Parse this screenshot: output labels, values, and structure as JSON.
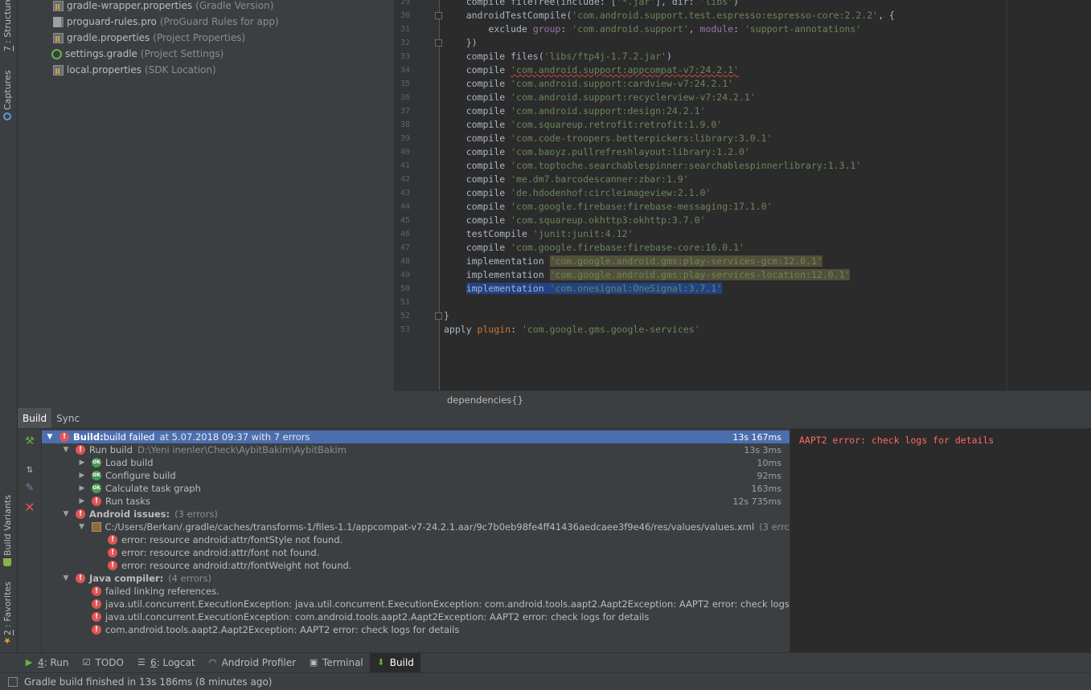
{
  "left_strip": {
    "structure_number": "7",
    "structure_rest": ": Structure",
    "captures": "Captures",
    "build_variants": "Build Variants",
    "favorites_number": "2",
    "favorites_rest": ": Favorites"
  },
  "project_tree": [
    {
      "name": "gradle-wrapper.properties",
      "hint": "(Gradle Version)",
      "icon": "properties-file-icon"
    },
    {
      "name": "proguard-rules.pro",
      "hint": "(ProGuard Rules for app)",
      "icon": "text-file-icon"
    },
    {
      "name": "gradle.properties",
      "hint": "(Project Properties)",
      "icon": "properties-file-icon"
    },
    {
      "name": "settings.gradle",
      "hint": "(Project Settings)",
      "icon": "gradle-file-icon"
    },
    {
      "name": "local.properties",
      "hint": "(SDK Location)",
      "icon": "properties-file-icon"
    }
  ],
  "editor": {
    "line_numbers": [
      "29",
      "30",
      "31",
      "32",
      "33",
      "34",
      "35",
      "36",
      "37",
      "38",
      "39",
      "40",
      "41",
      "42",
      "43",
      "44",
      "45",
      "46",
      "47",
      "48",
      "49",
      "50",
      "51",
      "52",
      "53"
    ],
    "lines": [
      {
        "indent": "    ",
        "kw": "compile fileTree(include: [",
        "str": "'*.jar'",
        "rest": "], dir: ",
        "str2": "'libs'",
        "rest2": ")"
      },
      {
        "indent": "    ",
        "kw": "androidTestCompile(",
        "str": "'com.android.support.test.espresso:espresso-core:2.2.2'",
        "rest": ", {",
        "str2": "",
        "rest2": ""
      },
      {
        "indent": "        ",
        "kw": "exclude ",
        "str": "",
        "rest": "",
        "group_line": true
      },
      {
        "indent": "    ",
        "kw": "})",
        "str": "",
        "rest": ""
      },
      {
        "indent": "    ",
        "kw": "compile files(",
        "str": "'libs/ftp4j-1.7.2.jar'",
        "rest": ")"
      },
      {
        "indent": "    ",
        "kw": "compile ",
        "str": "'com.android.support:appcompat-v7:24.2.1'",
        "rest": "",
        "err": true
      },
      {
        "indent": "    ",
        "kw": "compile ",
        "str": "'com.android.support:cardview-v7:24.2.1'",
        "rest": ""
      },
      {
        "indent": "    ",
        "kw": "compile ",
        "str": "'com.android.support:recyclerview-v7:24.2.1'",
        "rest": ""
      },
      {
        "indent": "    ",
        "kw": "compile ",
        "str": "'com.android.support:design:24.2.1'",
        "rest": ""
      },
      {
        "indent": "    ",
        "kw": "compile ",
        "str": "'com.squareup.retrofit:retrofit:1.9.0'",
        "rest": ""
      },
      {
        "indent": "    ",
        "kw": "compile ",
        "str": "'com.code-troopers.betterpickers:library:3.0.1'",
        "rest": ""
      },
      {
        "indent": "    ",
        "kw": "compile ",
        "str": "'com.baoyz.pullrefreshlayout:library:1.2.0'",
        "rest": ""
      },
      {
        "indent": "    ",
        "kw": "compile ",
        "str": "'com.toptoche.searchablespinner:searchablespinnerlibrary:1.3.1'",
        "rest": ""
      },
      {
        "indent": "    ",
        "kw": "compile ",
        "str": "'me.dm7.barcodescanner:zbar:1.9'",
        "rest": ""
      },
      {
        "indent": "    ",
        "kw": "compile ",
        "str": "'de.hdodenhof:circleimageview:2.1.0'",
        "rest": ""
      },
      {
        "indent": "    ",
        "kw": "compile ",
        "str": "'com.google.firebase:firebase-messaging:17.1.0'",
        "rest": ""
      },
      {
        "indent": "    ",
        "kw": "compile ",
        "str": "'com.squareup.okhttp3:okhttp:3.7.0'",
        "rest": ""
      },
      {
        "indent": "    ",
        "kw": "testCompile ",
        "str": "'junit:junit:4.12'",
        "rest": ""
      },
      {
        "indent": "    ",
        "kw": "compile ",
        "str": "'com.google.firebase:firebase-core:16.0.1'",
        "rest": ""
      },
      {
        "indent": "    ",
        "kw": "implementation ",
        "str": "'com.google.android.gms:play-services-gcm:12.0.1'",
        "rest": "",
        "warn": true
      },
      {
        "indent": "    ",
        "kw": "implementation ",
        "str": "'com.google.android.gms:play-services-location:12.0.1'",
        "rest": "",
        "warn": true
      },
      {
        "indent": "    ",
        "kw": "implementation ",
        "str": "'com.onesignal:OneSignal:3.7.1'",
        "rest": "",
        "sel": true
      },
      {
        "indent": "",
        "kw": "",
        "str": "",
        "rest": ""
      },
      {
        "indent": "",
        "kw": "}",
        "str": "",
        "rest": ""
      },
      {
        "indent": "",
        "kw": "apply ",
        "str": "'com.google.gms.google-services'",
        "rest": "",
        "plugin_line": true
      }
    ],
    "exclude_group_key": "group",
    "exclude_group_val": "'com.android.support'",
    "exclude_module_key": "module",
    "exclude_module_val": "'support-annotations'",
    "plugin_key": "plugin",
    "breadcrumb": "dependencies{}"
  },
  "build_window": {
    "tabs": [
      "Build",
      "Sync"
    ],
    "active_tab": "Build",
    "rows": [
      {
        "indent": 0,
        "arrow": "open",
        "icon": "err",
        "label": "Build:",
        "bold_label": true,
        "text": " build failed",
        "dim": "at 5.07.2018 09:37   with 7 errors",
        "dur": "13s 167ms",
        "sel": true
      },
      {
        "indent": 1,
        "arrow": "open",
        "icon": "err",
        "label": "Run build",
        "dim": "D:\\Yeni inenler\\Check\\AybitBakim\\AybitBakim",
        "dur": "13s 3ms"
      },
      {
        "indent": 2,
        "arrow": "closed",
        "icon": "ok",
        "label": "Load build",
        "dur": "10ms"
      },
      {
        "indent": 2,
        "arrow": "closed",
        "icon": "ok",
        "label": "Configure build",
        "dur": "92ms"
      },
      {
        "indent": 2,
        "arrow": "closed",
        "icon": "ok",
        "label": "Calculate task graph",
        "dur": "163ms"
      },
      {
        "indent": 2,
        "arrow": "closed",
        "icon": "err",
        "label": "Run tasks",
        "dur": "12s 735ms"
      },
      {
        "indent": 1,
        "arrow": "open",
        "icon": "err",
        "label": "Android issues:",
        "bold_label": true,
        "dim": "(3 errors)"
      },
      {
        "indent": 2,
        "arrow": "open",
        "icon": "file",
        "label": "C:/Users/Berkan/.gradle/caches/transforms-1/files-1.1/appcompat-v7-24.2.1.aar/9c7b0eb98fe4ff41436aedcaee3f9e46/res/values/values.xml",
        "dim": "(3 errc"
      },
      {
        "indent": 3,
        "arrow": "none",
        "icon": "err",
        "label": "error: resource android:attr/fontStyle not found."
      },
      {
        "indent": 3,
        "arrow": "none",
        "icon": "err",
        "label": "error: resource android:attr/font not found."
      },
      {
        "indent": 3,
        "arrow": "none",
        "icon": "err",
        "label": "error: resource android:attr/fontWeight not found."
      },
      {
        "indent": 1,
        "arrow": "open",
        "icon": "err",
        "label": "Java compiler:",
        "bold_label": true,
        "dim": "(4 errors)"
      },
      {
        "indent": 2,
        "arrow": "none",
        "icon": "err",
        "label": "failed linking references."
      },
      {
        "indent": 2,
        "arrow": "none",
        "icon": "err",
        "label": "java.util.concurrent.ExecutionException: java.util.concurrent.ExecutionException: com.android.tools.aapt2.Aapt2Exception: AAPT2 error: check logs"
      },
      {
        "indent": 2,
        "arrow": "none",
        "icon": "err",
        "label": "java.util.concurrent.ExecutionException: com.android.tools.aapt2.Aapt2Exception: AAPT2 error: check logs for details"
      },
      {
        "indent": 2,
        "arrow": "none",
        "icon": "err",
        "label": "com.android.tools.aapt2.Aapt2Exception: AAPT2 error: check logs for details"
      }
    ],
    "output": "AAPT2 error: check logs for details"
  },
  "bottom_tools": [
    {
      "num": "4",
      "rest": ": Run",
      "icon": "run-icon",
      "name": "run"
    },
    {
      "num": "",
      "rest": "TODO",
      "icon": "todo-icon",
      "name": "todo"
    },
    {
      "num": "6",
      "rest": ": Logcat",
      "icon": "logcat-icon",
      "name": "logcat"
    },
    {
      "num": "",
      "rest": "Android Profiler",
      "icon": "profiler-icon",
      "name": "android-profiler"
    },
    {
      "num": "",
      "rest": "Terminal",
      "icon": "terminal-icon",
      "name": "terminal"
    },
    {
      "num": "",
      "rest": "Build",
      "icon": "build-icon",
      "name": "build",
      "active": true
    }
  ],
  "status": "Gradle build finished in 13s 186ms (8 minutes ago)",
  "colors": {
    "error": "#e05555",
    "ok": "#499c54",
    "selection": "#4b6eaf",
    "string": "#6a8759"
  }
}
